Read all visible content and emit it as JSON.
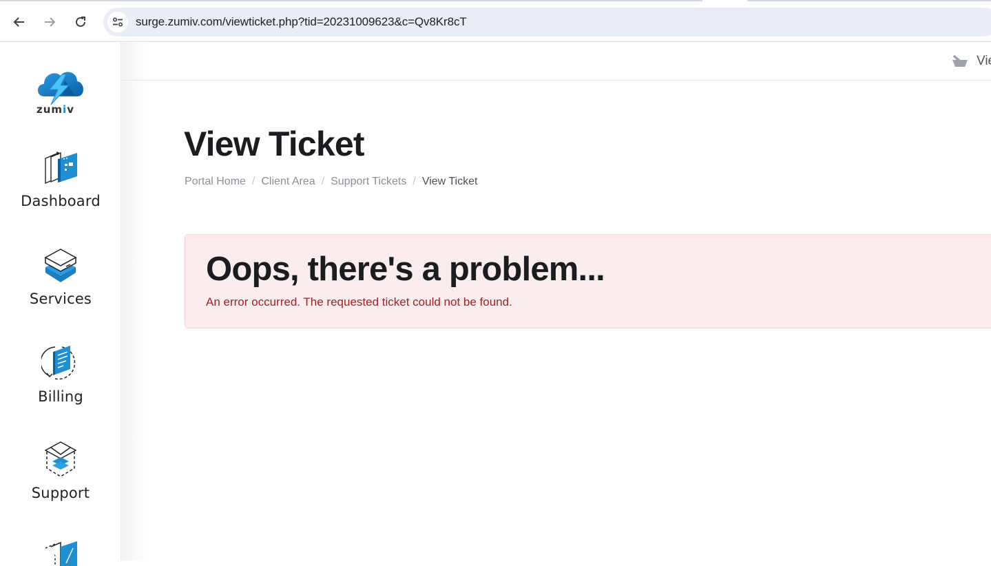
{
  "browser": {
    "url": "surge.zumiv.com/viewticket.php?tid=20231009623&c=Qv8Kr8cT",
    "back_icon": "arrow-left-icon",
    "forward_icon": "arrow-right-icon",
    "reload_icon": "reload-icon",
    "site_info_icon": "tune-icon"
  },
  "brand": {
    "name_prefix": "zum",
    "name_i": "i",
    "name_suffix": "v",
    "primary_color": "#1e88c8"
  },
  "sidebar": {
    "items": [
      {
        "label": "Dashboard",
        "icon": "dashboard-icon"
      },
      {
        "label": "Services",
        "icon": "server-icon"
      },
      {
        "label": "Billing",
        "icon": "invoice-icon"
      },
      {
        "label": "Support",
        "icon": "envelope-icon"
      },
      {
        "label": "",
        "icon": "domains-icon"
      }
    ]
  },
  "header": {
    "cart_label": "Vie",
    "cart_icon": "basket-icon"
  },
  "page": {
    "title": "View Ticket",
    "breadcrumb": [
      {
        "label": "Portal Home"
      },
      {
        "label": "Client Area"
      },
      {
        "label": "Support Tickets"
      },
      {
        "label": "View Ticket"
      }
    ],
    "breadcrumb_separator": "/"
  },
  "alert": {
    "title": "Oops, there's a problem...",
    "message": "An error occurred. The requested ticket could not be found.",
    "text_color": "#a02128",
    "background": "#fbeced"
  }
}
